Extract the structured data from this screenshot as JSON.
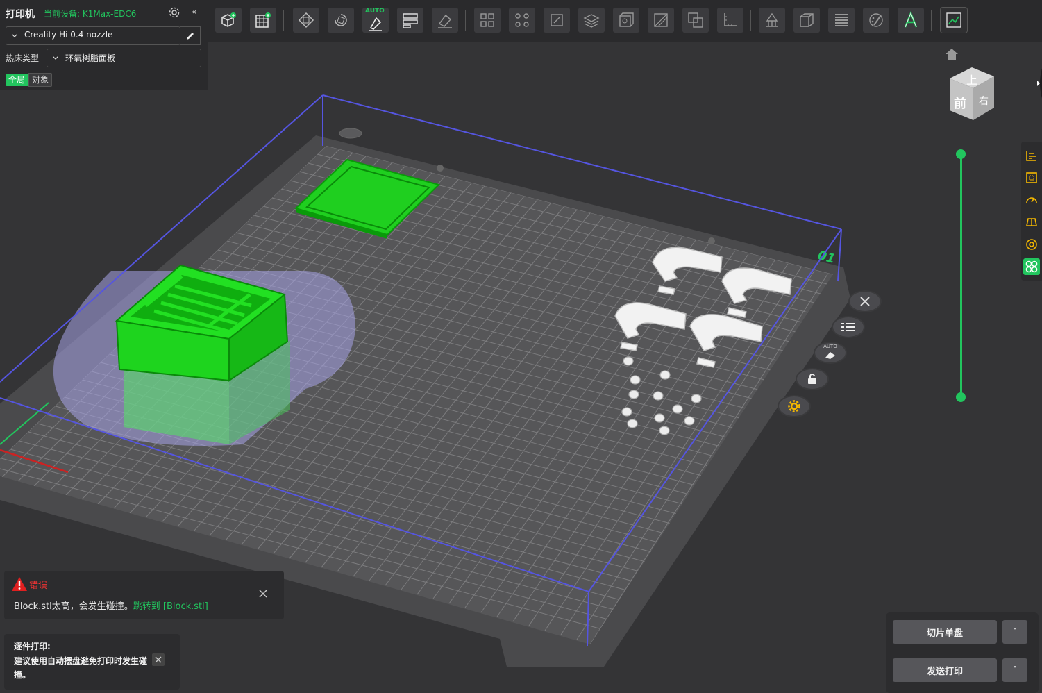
{
  "top_panel": {
    "title": "打印机",
    "current_device": "当前设备: K1Max-EDC6",
    "collapse_glyph": "«",
    "printer_profile": "Creality Hi 0.4 nozzle",
    "bed_type_label": "热床类型",
    "bed_type_value": "环氧树脂面板",
    "tab_global": "全局",
    "tab_object": "对象"
  },
  "toolbar": {
    "auto_badge": "AUTO",
    "items": [
      "add-object",
      "add-plate",
      "arrange",
      "auto-orient",
      "auto-support",
      "layout",
      "paint-support",
      "move",
      "scale",
      "fit-to-bed",
      "hollow",
      "shell",
      "cut",
      "boolean",
      "measure",
      "support-blocker",
      "mesh-repair",
      "layers",
      "color-paint",
      "text",
      "assemble"
    ]
  },
  "viewcube": {
    "top": "上",
    "front": "前",
    "right": "右"
  },
  "plate": {
    "number": "01",
    "auto_badge": "AUTO"
  },
  "error": {
    "title": "错误",
    "message": "Block.stl太高，会发生碰撞。",
    "link": "跳转到 [Block.stl]"
  },
  "tip": {
    "title": "逐件打印:",
    "text": "建议使用自动摆盘避免打印时发生碰撞。"
  },
  "actions": {
    "slice_label": "切片单盘",
    "send_label": "发送打印",
    "expand_glyph": "˄"
  },
  "colors": {
    "accent": "#22c55e",
    "error": "#e33333",
    "build_volume": "#5555e0"
  }
}
